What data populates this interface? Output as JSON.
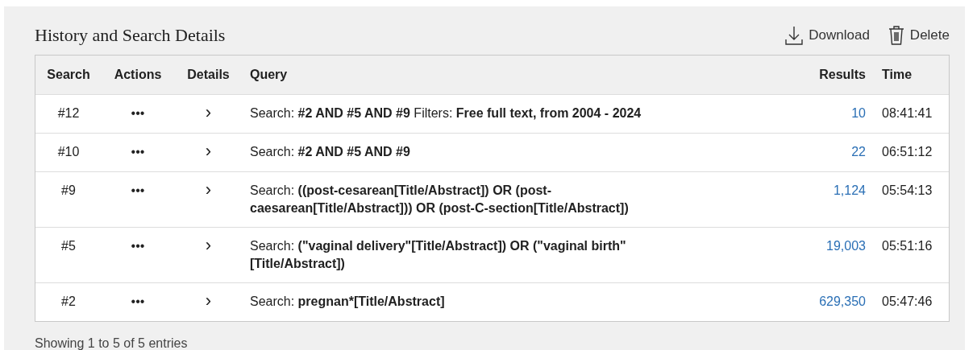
{
  "title": "History and Search Details",
  "actions": [
    {
      "kind": "download",
      "label": "Download"
    },
    {
      "kind": "delete",
      "label": "Delete"
    }
  ],
  "table": {
    "columns": [
      "Search",
      "Actions",
      "Details",
      "Query",
      "Results",
      "Time"
    ],
    "rows": [
      {
        "search": "#12",
        "actions": "•••",
        "details": "›",
        "query": "Search: **#2 AND #5 AND #9** Filters: **Free full text, from 2004 - 2024**",
        "results": "10",
        "time": "08:41:41"
      },
      {
        "search": "#10",
        "actions": "•••",
        "details": "›",
        "query": "Search: **#2 AND #5 AND #9**",
        "results": "22",
        "time": "06:51:12"
      },
      {
        "search": "#9",
        "actions": "•••",
        "details": "›",
        "query": "Search: **((post-cesarean[Title/Abstract]) OR (post-caesarean[Title/Abstract])) OR (post-C-section[Title/Abstract])**",
        "results": "1,124",
        "time": "05:54:13"
      },
      {
        "search": "#5",
        "actions": "•••",
        "details": "›",
        "query": "Search: **(\"vaginal delivery\"[Title/Abstract]) OR (\"vaginal birth\" [Title/Abstract])**",
        "results": "19,003",
        "time": "05:51:16"
      },
      {
        "search": "#2",
        "actions": "•••",
        "details": "›",
        "query": "Search: **pregnan*[Title/Abstract]**",
        "results": "629,350",
        "time": "05:47:46"
      }
    ]
  },
  "footer": "Showing 1 to 5 of 5 entries"
}
